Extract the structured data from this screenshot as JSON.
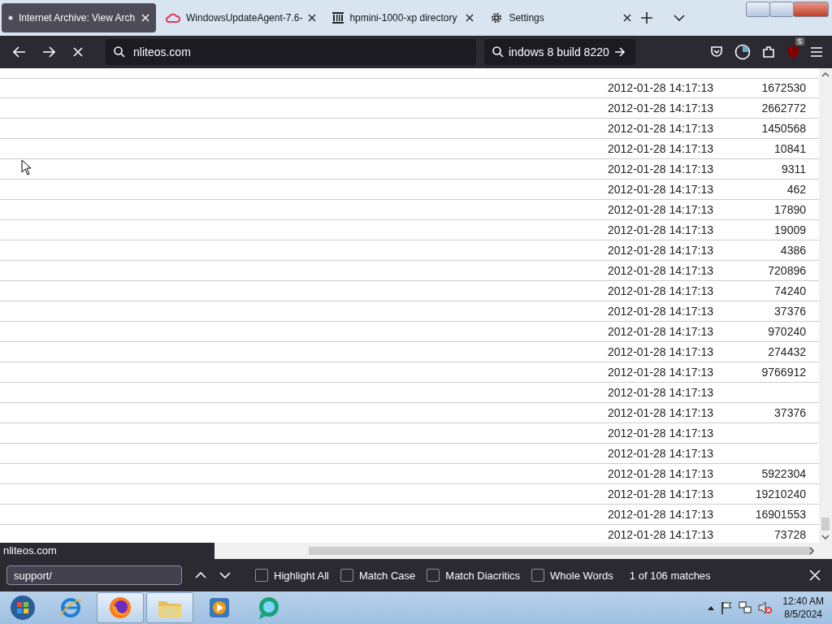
{
  "tabs": [
    {
      "title": "Internet Archive: View Arch",
      "selected": true
    },
    {
      "title": "WindowsUpdateAgent-7.6-",
      "selected": false
    },
    {
      "title": "hpmini-1000-xp directory",
      "selected": false
    },
    {
      "title": "Settings",
      "selected": false
    }
  ],
  "toolbar": {
    "address": "nliteos.com",
    "search": "indows 8 build 8220",
    "extension_badge": "5"
  },
  "rows": [
    {
      "date": "2012-01-28 14:17:13",
      "size": "1672530"
    },
    {
      "date": "2012-01-28 14:17:13",
      "size": "2662772"
    },
    {
      "date": "2012-01-28 14:17:13",
      "size": "1450568"
    },
    {
      "date": "2012-01-28 14:17:13",
      "size": "10841"
    },
    {
      "date": "2012-01-28 14:17:13",
      "size": "9311"
    },
    {
      "date": "2012-01-28 14:17:13",
      "size": "462"
    },
    {
      "date": "2012-01-28 14:17:13",
      "size": "17890"
    },
    {
      "date": "2012-01-28 14:17:13",
      "size": "19009"
    },
    {
      "date": "2012-01-28 14:17:13",
      "size": "4386"
    },
    {
      "date": "2012-01-28 14:17:13",
      "size": "720896"
    },
    {
      "date": "2012-01-28 14:17:13",
      "size": "74240"
    },
    {
      "date": "2012-01-28 14:17:13",
      "size": "37376"
    },
    {
      "date": "2012-01-28 14:17:13",
      "size": "970240"
    },
    {
      "date": "2012-01-28 14:17:13",
      "size": "274432"
    },
    {
      "date": "2012-01-28 14:17:13",
      "size": "9766912"
    },
    {
      "date": "2012-01-28 14:17:13"
    },
    {
      "date": "2012-01-28 14:17:13",
      "size": "37376"
    },
    {
      "date": "2012-01-28 14:17:13"
    },
    {
      "date": "2012-01-28 14:17:13"
    },
    {
      "date": "2012-01-28 14:17:13",
      "size": "5922304"
    },
    {
      "date": "2012-01-28 14:17:13",
      "size": "19210240"
    },
    {
      "date": "2012-01-28 14:17:13",
      "size": "16901553"
    },
    {
      "date": "2012-01-28 14:17:13",
      "size": "73728"
    }
  ],
  "status_url": "nliteos.com",
  "find_bar": {
    "query": "support/",
    "options": [
      {
        "label": "Highlight All",
        "checked": false
      },
      {
        "label": "Match Case",
        "checked": false
      },
      {
        "label": "Match Diacritics",
        "checked": false
      },
      {
        "label": "Whole Words",
        "checked": false
      }
    ],
    "result": "1 of 106 matches"
  },
  "taskbar": {
    "apps": [
      {
        "kind": "ie",
        "selected": false
      },
      {
        "kind": "firefox",
        "selected": true
      },
      {
        "kind": "folder",
        "selected": true
      },
      {
        "kind": "media",
        "selected": false
      },
      {
        "kind": "chat",
        "selected": false
      }
    ],
    "time": "12:40 AM",
    "date": "8/5/2024"
  }
}
